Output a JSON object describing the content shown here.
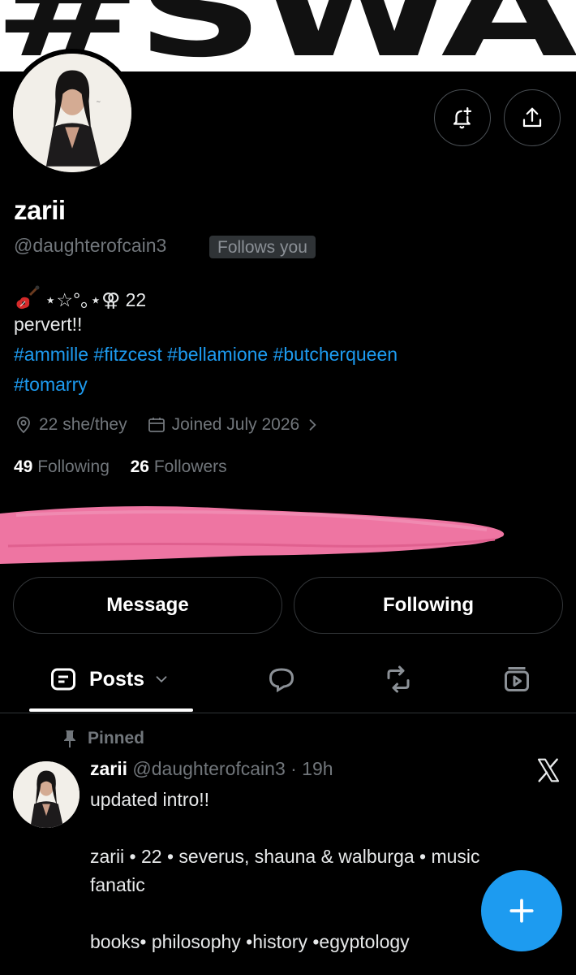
{
  "banner": {
    "text": "#SWAG"
  },
  "profile": {
    "name": "zarii",
    "handle": "@daughterofcain3",
    "follows_you": "Follows you",
    "bio_line1": "⋆☆°｡⋆⚢ 22",
    "bio_line2": "pervert!!",
    "bio_tags_line1": "#ammille #fitzcest #bellamione #butcherqueen",
    "bio_tags_line2": "#tomarry",
    "location": "22 she/they",
    "joined": "Joined July 2026",
    "following_count": "49",
    "following_label": "Following",
    "followers_count": "26",
    "followers_label": "Followers"
  },
  "actions": {
    "message": "Message",
    "following": "Following"
  },
  "tabs": {
    "posts": "Posts"
  },
  "post": {
    "pinned": "Pinned",
    "name": "zarii",
    "handle_time": "@daughterofcain3 · 19h",
    "line1": "updated intro!!",
    "line2": "zarii • 22 • severus, shauna & walburga • music",
    "line3": "fanatic",
    "line4": "books• philosophy •history •egyptology"
  },
  "colors": {
    "accent": "#1d9bf0",
    "redaction": "#ee75a2",
    "muted": "#71767b"
  },
  "icons": [
    "bell-plus-icon",
    "share-icon",
    "location-icon",
    "calendar-icon",
    "chevron-right-icon",
    "posts-icon",
    "chevron-down-icon",
    "reply-icon",
    "repost-icon",
    "media-icon",
    "pin-icon",
    "x-logo-icon",
    "plus-icon",
    "guitar-icon"
  ]
}
